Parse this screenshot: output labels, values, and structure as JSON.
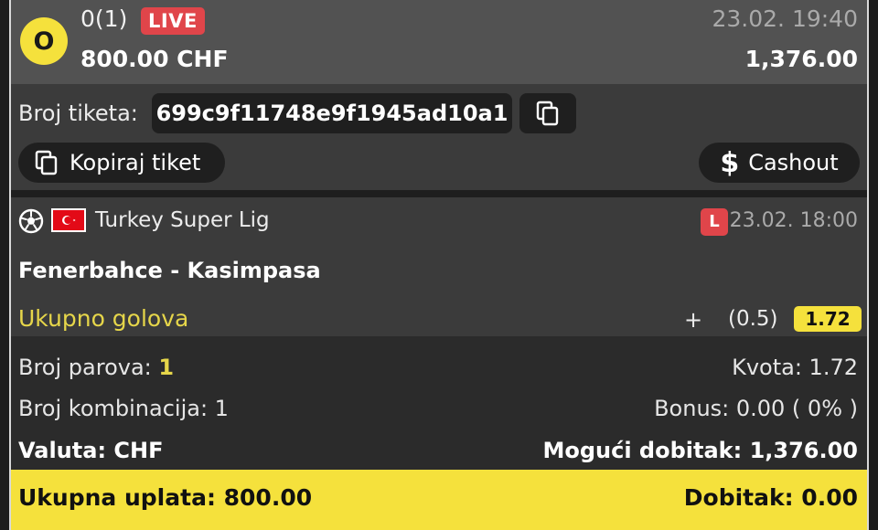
{
  "header": {
    "status_letter": "O",
    "match_count": "0(1)",
    "live_label": "LIVE",
    "datetime": "23.02. 19:40",
    "stake": "800.00 CHF",
    "potential_win": "1,376.00"
  },
  "ticket": {
    "label": "Broj tiketa:",
    "id": "699c9f11748e9f1945ad10a1",
    "copy_ticket_label": "Kopiraj tiket",
    "cashout_label": "Cashout"
  },
  "match": {
    "league": "Turkey Super Lig",
    "status_badge": "L",
    "datetime": "23.02. 18:00",
    "teams": "Fenerbahce - Kasimpasa",
    "market": "Ukupno golova",
    "pick_sign": "+",
    "pick_line": "(0.5)",
    "odd": "1.72"
  },
  "summary": {
    "pairs_label": "Broj parova:",
    "pairs_value": "1",
    "odds_text": "Kvota: 1.72",
    "combinations_text": "Broj kombinacija: 1",
    "bonus_text": "Bonus: 0.00 ( 0% )",
    "currency_text": "Valuta: CHF",
    "possible_win_text": "Mogući dobitak: 1,376.00"
  },
  "footer": {
    "total_stake": "Ukupna uplata: 800.00",
    "win": "Dobitak: 0.00"
  },
  "colors": {
    "accent_yellow": "#f5e13c",
    "live_red": "#e0454a",
    "market_yellow": "#e6d64a",
    "flag_red": "#e30a17"
  },
  "icons": [
    "copy-icon",
    "dollar-icon",
    "soccer-ball-icon",
    "turkey-flag-icon"
  ]
}
